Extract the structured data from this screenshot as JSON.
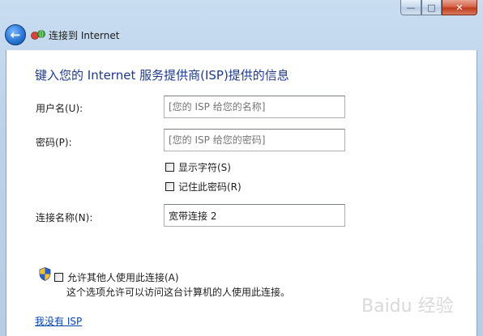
{
  "window": {
    "title": "连接到 Internet"
  },
  "heading": "键入您的 Internet 服务提供商(ISP)提供的信息",
  "form": {
    "username_label": "用户名(U):",
    "username_placeholder": "[您的 ISP 给您的名称]",
    "password_label": "密码(P):",
    "password_placeholder": "[您的 ISP 给您的密码]",
    "show_chars_label": "显示字符(S)",
    "remember_password_label": "记住此密码(R)",
    "connection_name_label": "连接名称(N):",
    "connection_name_value": "宽带连接 2"
  },
  "allow_others": {
    "label": "允许其他人使用此连接(A)",
    "note": "这个选项允许可以访问这台计算机的人使用此连接。"
  },
  "no_isp_link": "我没有 ISP",
  "watermark": "Baidu 经验",
  "icons": {
    "back": "back-arrow-icon",
    "network": "network-globe-icon",
    "shield": "uac-shield-icon"
  },
  "colors": {
    "heading": "#1f3a8a",
    "link": "#0645ad",
    "frame": "#bcd2ea"
  }
}
